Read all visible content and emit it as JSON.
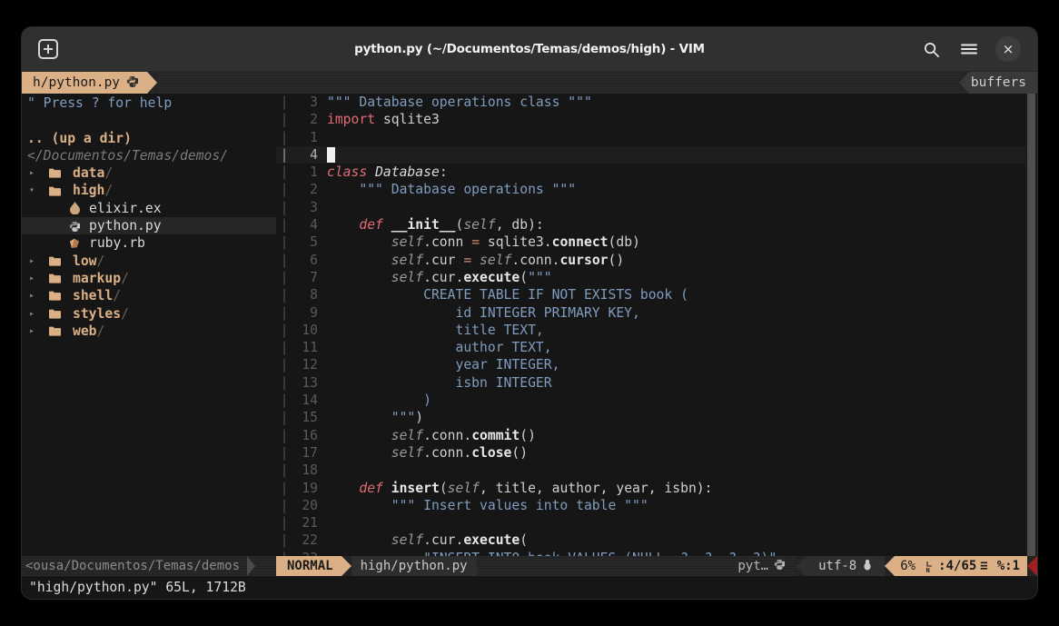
{
  "window": {
    "title": "python.py (~/Documentos/Temas/demos/high) - VIM",
    "new_tab_label": "+",
    "search_icon": "search-icon",
    "menu_icon": "hamburger-menu-icon",
    "close_icon": "×"
  },
  "tabline": {
    "active_tab": "h/python.py",
    "active_tab_icon": "python-logo-icon",
    "buffers_label": "buffers"
  },
  "netrw": {
    "help_line": "\" Press ? for help",
    "blank_line": "",
    "up_dir": ".. (up a dir)",
    "current_path": "</Documentos/Temas/demos/",
    "entries": [
      {
        "arrow": "▸",
        "icon": "folder-icon",
        "name": "data",
        "slash": "/",
        "kind": "dir",
        "selected": false
      },
      {
        "arrow": "▾",
        "icon": "folder-open-icon",
        "name": "high",
        "slash": "/",
        "kind": "dir",
        "selected": false
      },
      {
        "arrow": "",
        "icon": "elixir-drop-icon",
        "name": "elixir.ex",
        "slash": "",
        "kind": "file",
        "selected": false
      },
      {
        "arrow": "",
        "icon": "python-logo-icon",
        "name": "python.py",
        "slash": "",
        "kind": "file",
        "selected": true
      },
      {
        "arrow": "",
        "icon": "ruby-gem-icon",
        "name": "ruby.rb",
        "slash": "",
        "kind": "file",
        "selected": false
      },
      {
        "arrow": "▸",
        "icon": "folder-icon",
        "name": "low",
        "slash": "/",
        "kind": "dir",
        "selected": false
      },
      {
        "arrow": "▸",
        "icon": "folder-icon",
        "name": "markup",
        "slash": "/",
        "kind": "dir",
        "selected": false
      },
      {
        "arrow": "▸",
        "icon": "folder-icon",
        "name": "shell",
        "slash": "/",
        "kind": "dir",
        "selected": false
      },
      {
        "arrow": "▸",
        "icon": "folder-icon",
        "name": "styles",
        "slash": "/",
        "kind": "dir",
        "selected": false
      },
      {
        "arrow": "▸",
        "icon": "folder-icon",
        "name": "web",
        "slash": "/",
        "kind": "dir",
        "selected": false
      }
    ]
  },
  "editor": {
    "fold_marker": "|",
    "cursor_abs_line": "4",
    "lines": [
      {
        "num": "3",
        "cursor": false,
        "tokens": [
          {
            "t": "\"\"\" Database operations class \"\"\"",
            "c": "s-str"
          }
        ]
      },
      {
        "num": "2",
        "cursor": false,
        "tokens": [
          {
            "t": "import",
            "c": "s-kw2"
          },
          {
            "t": " sqlite3",
            "c": "s-plain"
          }
        ]
      },
      {
        "num": "1",
        "cursor": false,
        "tokens": []
      },
      {
        "num": "4",
        "cursor": true,
        "abs": true,
        "tokens": []
      },
      {
        "num": "1",
        "cursor": false,
        "tokens": [
          {
            "t": "class",
            "c": "s-kw"
          },
          {
            "t": " ",
            "c": "s-plain"
          },
          {
            "t": "Database",
            "c": "s-type"
          },
          {
            "t": ":",
            "c": "s-punct"
          }
        ]
      },
      {
        "num": "2",
        "cursor": false,
        "tokens": [
          {
            "t": "    \"\"\" Database operations \"\"\"",
            "c": "s-str"
          }
        ]
      },
      {
        "num": "3",
        "cursor": false,
        "tokens": []
      },
      {
        "num": "4",
        "cursor": false,
        "tokens": [
          {
            "t": "    ",
            "c": "s-plain"
          },
          {
            "t": "def",
            "c": "s-kw"
          },
          {
            "t": " ",
            "c": "s-plain"
          },
          {
            "t": "__init__",
            "c": "s-fn"
          },
          {
            "t": "(",
            "c": "s-punct"
          },
          {
            "t": "self",
            "c": "s-self"
          },
          {
            "t": ", db):",
            "c": "s-plain"
          }
        ]
      },
      {
        "num": "5",
        "cursor": false,
        "tokens": [
          {
            "t": "        ",
            "c": "s-plain"
          },
          {
            "t": "self",
            "c": "s-self"
          },
          {
            "t": ".conn ",
            "c": "s-plain"
          },
          {
            "t": "=",
            "c": "s-op"
          },
          {
            "t": " sqlite3.",
            "c": "s-plain"
          },
          {
            "t": "connect",
            "c": "s-fn"
          },
          {
            "t": "(db)",
            "c": "s-plain"
          }
        ]
      },
      {
        "num": "6",
        "cursor": false,
        "tokens": [
          {
            "t": "        ",
            "c": "s-plain"
          },
          {
            "t": "self",
            "c": "s-self"
          },
          {
            "t": ".cur ",
            "c": "s-plain"
          },
          {
            "t": "=",
            "c": "s-op"
          },
          {
            "t": " ",
            "c": "s-plain"
          },
          {
            "t": "self",
            "c": "s-self"
          },
          {
            "t": ".conn.",
            "c": "s-plain"
          },
          {
            "t": "cursor",
            "c": "s-fn"
          },
          {
            "t": "()",
            "c": "s-plain"
          }
        ]
      },
      {
        "num": "7",
        "cursor": false,
        "tokens": [
          {
            "t": "        ",
            "c": "s-plain"
          },
          {
            "t": "self",
            "c": "s-self"
          },
          {
            "t": ".cur.",
            "c": "s-plain"
          },
          {
            "t": "execute",
            "c": "s-fn"
          },
          {
            "t": "(",
            "c": "s-plain"
          },
          {
            "t": "\"\"\"",
            "c": "s-str"
          }
        ]
      },
      {
        "num": "8",
        "cursor": false,
        "tokens": [
          {
            "t": "            CREATE TABLE IF NOT EXISTS book (",
            "c": "s-str"
          }
        ]
      },
      {
        "num": "9",
        "cursor": false,
        "tokens": [
          {
            "t": "                id INTEGER PRIMARY KEY,",
            "c": "s-str"
          }
        ]
      },
      {
        "num": "10",
        "cursor": false,
        "tokens": [
          {
            "t": "                title TEXT,",
            "c": "s-str"
          }
        ]
      },
      {
        "num": "11",
        "cursor": false,
        "tokens": [
          {
            "t": "                author TEXT,",
            "c": "s-str"
          }
        ]
      },
      {
        "num": "12",
        "cursor": false,
        "tokens": [
          {
            "t": "                year INTEGER,",
            "c": "s-str"
          }
        ]
      },
      {
        "num": "13",
        "cursor": false,
        "tokens": [
          {
            "t": "                isbn INTEGER",
            "c": "s-str"
          }
        ]
      },
      {
        "num": "14",
        "cursor": false,
        "tokens": [
          {
            "t": "            )",
            "c": "s-str"
          }
        ]
      },
      {
        "num": "15",
        "cursor": false,
        "tokens": [
          {
            "t": "        \"\"\"",
            "c": "s-str"
          },
          {
            "t": ")",
            "c": "s-plain"
          }
        ]
      },
      {
        "num": "16",
        "cursor": false,
        "tokens": [
          {
            "t": "        ",
            "c": "s-plain"
          },
          {
            "t": "self",
            "c": "s-self"
          },
          {
            "t": ".conn.",
            "c": "s-plain"
          },
          {
            "t": "commit",
            "c": "s-fn"
          },
          {
            "t": "()",
            "c": "s-plain"
          }
        ]
      },
      {
        "num": "17",
        "cursor": false,
        "tokens": [
          {
            "t": "        ",
            "c": "s-plain"
          },
          {
            "t": "self",
            "c": "s-self"
          },
          {
            "t": ".conn.",
            "c": "s-plain"
          },
          {
            "t": "close",
            "c": "s-fn"
          },
          {
            "t": "()",
            "c": "s-plain"
          }
        ]
      },
      {
        "num": "18",
        "cursor": false,
        "tokens": []
      },
      {
        "num": "19",
        "cursor": false,
        "tokens": [
          {
            "t": "    ",
            "c": "s-plain"
          },
          {
            "t": "def",
            "c": "s-kw"
          },
          {
            "t": " ",
            "c": "s-plain"
          },
          {
            "t": "insert",
            "c": "s-fn"
          },
          {
            "t": "(",
            "c": "s-punct"
          },
          {
            "t": "self",
            "c": "s-self"
          },
          {
            "t": ", title, author, year, isbn):",
            "c": "s-plain"
          }
        ]
      },
      {
        "num": "20",
        "cursor": false,
        "tokens": [
          {
            "t": "        \"\"\" Insert values into table \"\"\"",
            "c": "s-str"
          }
        ]
      },
      {
        "num": "21",
        "cursor": false,
        "tokens": []
      },
      {
        "num": "22",
        "cursor": false,
        "tokens": [
          {
            "t": "        ",
            "c": "s-plain"
          },
          {
            "t": "self",
            "c": "s-self"
          },
          {
            "t": ".cur.",
            "c": "s-plain"
          },
          {
            "t": "execute",
            "c": "s-fn"
          },
          {
            "t": "(",
            "c": "s-plain"
          }
        ]
      },
      {
        "num": "23",
        "cursor": false,
        "tokens": [
          {
            "t": "            \"INSERT INTO book VALUES (NULL, ?, ?, ?, ?)\",",
            "c": "s-str"
          }
        ]
      }
    ]
  },
  "statusline": {
    "netrw_path": "<ousa/Documentos/Temas/demos",
    "mode": "NORMAL",
    "file_path": "high/python.py",
    "filetype": "pyt…",
    "filetype_icon": "python-logo-icon",
    "encoding": "utf-8",
    "encoding_icon": "linux-tux-icon",
    "percent": "6%",
    "line_icon": "line-number-icon",
    "line_position": ":4/65",
    "column_icon": "≡",
    "column_position": "%:1"
  },
  "cmdline": {
    "message": "\"high/python.py\" 65L, 1712B"
  },
  "colors": {
    "accent": "#dcb086",
    "background": "#161616",
    "titlebar": "#303030",
    "string": "#7f9cbf",
    "keyword": "#e06c75",
    "close_red": "#a02020"
  }
}
